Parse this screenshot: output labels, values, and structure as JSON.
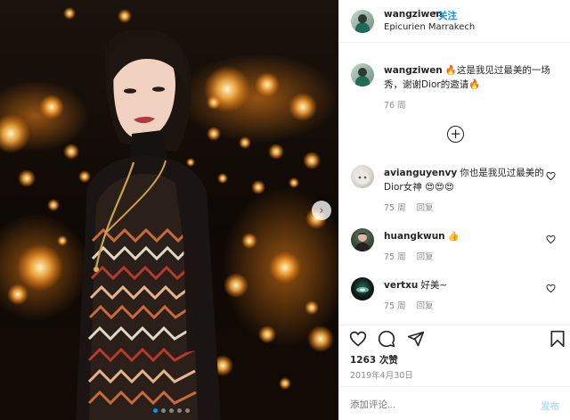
{
  "post": {
    "dots_count": 5,
    "active_dot": 0
  },
  "header": {
    "username": "wangziwen",
    "separator": "•",
    "follow_label": "关注",
    "location": "Epicurien Marrakech"
  },
  "caption": {
    "username": "wangziwen",
    "text": "🔥这是我见过最美的一场秀，谢谢Dior的邀请🔥",
    "time": "76 周"
  },
  "load_more_icon": "plus-circle-icon",
  "comments": [
    {
      "username": "avianguyenvy",
      "text": "你也是我见过最美的Dior女神 😍😍😍",
      "time": "75 周",
      "reply_label": "回复",
      "avatar_color": "#d8d4cf"
    },
    {
      "username": "huangkwun",
      "text": "👍",
      "time": "75 周",
      "reply_label": "回复",
      "avatar_color": "#3b4a3a"
    },
    {
      "username": "vertxu",
      "text": "好美~",
      "time": "75 周",
      "reply_label": "回复",
      "avatar_color": "#0f1a17"
    }
  ],
  "actions": {
    "like_icon": "heart-icon",
    "comment_icon": "comment-icon",
    "share_icon": "paper-plane-icon",
    "save_icon": "bookmark-icon"
  },
  "likes": "1263 次赞",
  "date": "2019年4月30日",
  "add_comment": {
    "placeholder": "添加评论...",
    "post_label": "发布"
  },
  "colors": {
    "accent": "#0095f6",
    "muted": "#8e8e8e",
    "border": "#efefef"
  }
}
